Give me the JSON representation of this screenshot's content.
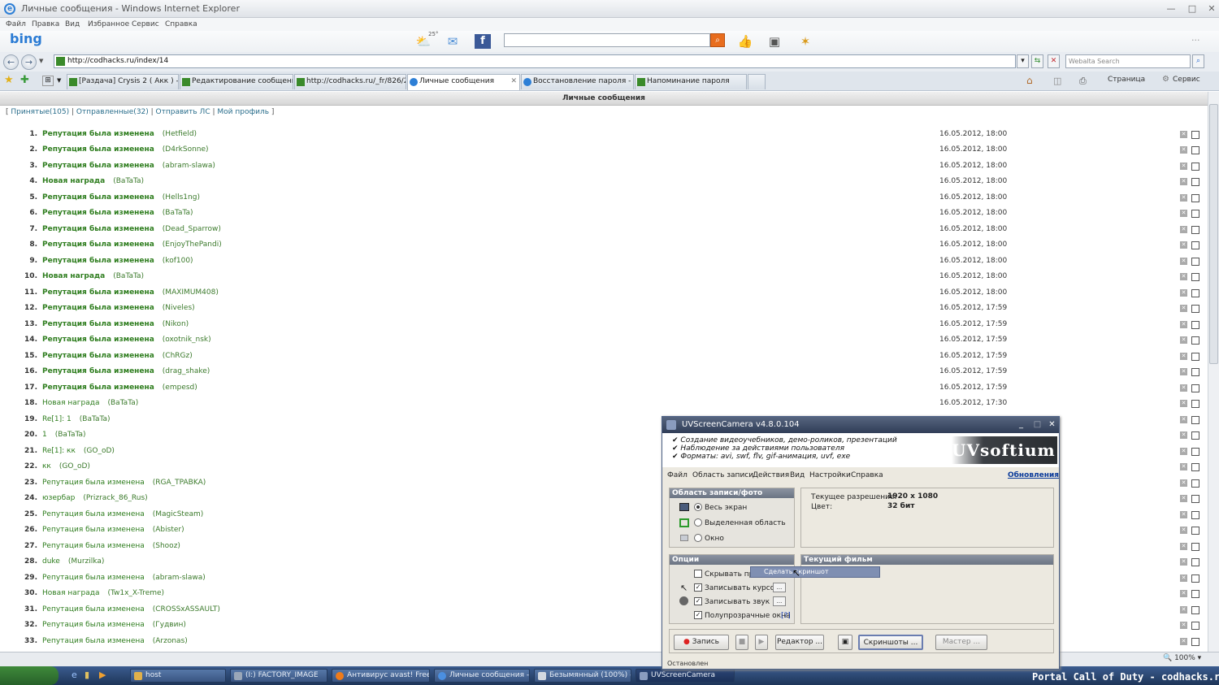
{
  "window": {
    "title": "Личные сообщения - Windows Internet Explorer"
  },
  "menu": [
    "Файл",
    "Правка",
    "Вид",
    "Избранное",
    "Сервис",
    "Справка"
  ],
  "bing": {
    "logo": "bing",
    "weather_temp": "25°"
  },
  "address": {
    "url": "http://codhacks.ru/index/14"
  },
  "websearch": {
    "placeholder": "Webalta Search"
  },
  "tabs": [
    "[Раздача] Crysis 2 ( Акк ) - ...",
    "Редактирование сообщени...",
    "http://codhacks.ru/_fr/826/2...",
    "Личные сообщения",
    "Восстановление пароля - w...",
    "Напоминание пароля"
  ],
  "commands": {
    "page": "Страница",
    "tools": "Сервис"
  },
  "page": {
    "header": "Личные сообщения",
    "links": {
      "inbox": "Принятые(105)",
      "sent": "Отправленные(32)",
      "send": "Отправить ЛС",
      "profile": "Мой профиль"
    },
    "messages": [
      {
        "n": "1.",
        "s": "Репутация была изменена",
        "a": "(Hetfield)",
        "d": "16.05.2012, 18:00",
        "bold": true
      },
      {
        "n": "2.",
        "s": "Репутация была изменена",
        "a": "(D4rkSonne)",
        "d": "16.05.2012, 18:00",
        "bold": true
      },
      {
        "n": "3.",
        "s": "Репутация была изменена",
        "a": "(abram-slawa)",
        "d": "16.05.2012, 18:00",
        "bold": true
      },
      {
        "n": "4.",
        "s": "Новая награда",
        "a": "(BaTaTa)",
        "d": "16.05.2012, 18:00",
        "bold": true
      },
      {
        "n": "5.",
        "s": "Репутация была изменена",
        "a": "(Hells1ng)",
        "d": "16.05.2012, 18:00",
        "bold": true
      },
      {
        "n": "6.",
        "s": "Репутация была изменена",
        "a": "(BaTaTa)",
        "d": "16.05.2012, 18:00",
        "bold": true
      },
      {
        "n": "7.",
        "s": "Репутация была изменена",
        "a": "(Dead_Sparrow)",
        "d": "16.05.2012, 18:00",
        "bold": true
      },
      {
        "n": "8.",
        "s": "Репутация была изменена",
        "a": "(EnjoyThePandi)",
        "d": "16.05.2012, 18:00",
        "bold": true
      },
      {
        "n": "9.",
        "s": "Репутация была изменена",
        "a": "(kof100)",
        "d": "16.05.2012, 18:00",
        "bold": true
      },
      {
        "n": "10.",
        "s": "Новая награда",
        "a": "(BaTaTa)",
        "d": "16.05.2012, 18:00",
        "bold": true
      },
      {
        "n": "11.",
        "s": "Репутация была изменена",
        "a": "(MAXIMUM408)",
        "d": "16.05.2012, 18:00",
        "bold": true
      },
      {
        "n": "12.",
        "s": "Репутация была изменена",
        "a": "(Niveles)",
        "d": "16.05.2012, 17:59",
        "bold": true
      },
      {
        "n": "13.",
        "s": "Репутация была изменена",
        "a": "(Nikon)",
        "d": "16.05.2012, 17:59",
        "bold": true
      },
      {
        "n": "14.",
        "s": "Репутация была изменена",
        "a": "(oxotnik_nsk)",
        "d": "16.05.2012, 17:59",
        "bold": true
      },
      {
        "n": "15.",
        "s": "Репутация была изменена",
        "a": "(ChRGz)",
        "d": "16.05.2012, 17:59",
        "bold": true
      },
      {
        "n": "16.",
        "s": "Репутация была изменена",
        "a": "(drag_shake)",
        "d": "16.05.2012, 17:59",
        "bold": true
      },
      {
        "n": "17.",
        "s": "Репутация была изменена",
        "a": "(empesd)",
        "d": "16.05.2012, 17:59",
        "bold": true
      },
      {
        "n": "18.",
        "s": "Новая награда",
        "a": "(BaTaTa)",
        "d": "16.05.2012, 17:30",
        "bold": false
      },
      {
        "n": "19.",
        "s": "Re[1]: 1",
        "a": "(BaTaTa)",
        "d": "",
        "bold": false
      },
      {
        "n": "20.",
        "s": "1",
        "a": "(BaTaTa)",
        "d": "",
        "bold": false
      },
      {
        "n": "21.",
        "s": "Re[1]: кк",
        "a": "(GO_oD)",
        "d": "",
        "bold": false
      },
      {
        "n": "22.",
        "s": "кк",
        "a": "(GO_oD)",
        "d": "",
        "bold": false
      },
      {
        "n": "23.",
        "s": "Репутация была изменена",
        "a": "(RGA_TPABKA)",
        "d": "",
        "bold": false
      },
      {
        "n": "24.",
        "s": "юзербар",
        "a": "(Prizrack_86_Rus)",
        "d": "",
        "bold": false
      },
      {
        "n": "25.",
        "s": "Репутация была изменена",
        "a": "(MagicSteam)",
        "d": "",
        "bold": false
      },
      {
        "n": "26.",
        "s": "Репутация была изменена",
        "a": "(Abister)",
        "d": "",
        "bold": false
      },
      {
        "n": "27.",
        "s": "Репутация была изменена",
        "a": "(Shooz)",
        "d": "",
        "bold": false
      },
      {
        "n": "28.",
        "s": "duke",
        "a": "(Murzilka)",
        "d": "",
        "bold": false
      },
      {
        "n": "29.",
        "s": "Репутация была изменена",
        "a": "(abram-slawa)",
        "d": "",
        "bold": false
      },
      {
        "n": "30.",
        "s": "Новая награда",
        "a": "(Tw1x_X-Treme)",
        "d": "",
        "bold": false
      },
      {
        "n": "31.",
        "s": "Репутация была изменена",
        "a": "(CROSSxASSAULT)",
        "d": "",
        "bold": false
      },
      {
        "n": "32.",
        "s": "Репутация была изменена",
        "a": "(Гудвин)",
        "d": "",
        "bold": false
      },
      {
        "n": "33.",
        "s": "Репутация была изменена",
        "a": "(Arzonas)",
        "d": "",
        "bold": false
      }
    ]
  },
  "status": {
    "zoom": "100%"
  },
  "taskbar": [
    "host",
    "(I:) FACTORY_IMAGE",
    "Антивирус avast! Free",
    "Личные сообщения - ...",
    "Безымянный (100%) -...",
    "UVScreenCamera"
  ],
  "watermark": "Portal Call of Duty - codhacks.ru",
  "uv": {
    "title": "UVScreenCamera v4.8.0.104",
    "features": [
      "Создание видеоучебников, демо-роликов, презентаций",
      "Наблюдение за действиями пользователя",
      "Форматы: avi, swf, flv, gif-анимация, uvf, exe"
    ],
    "logo": "UVsoftium",
    "menu": [
      "Файл",
      "Область записи",
      "Действия",
      "Вид",
      "Настройки",
      "Справка"
    ],
    "updates": "Обновления",
    "area": {
      "title": "Область записи/фото",
      "opts": [
        "Весь экран",
        "Выделенная область",
        "Окно"
      ]
    },
    "info": {
      "res_label": "Текущее разрешение:",
      "res": "1920 x 1080",
      "color_label": "Цвет:",
      "color": "32 бит"
    },
    "options": {
      "title": "Опции",
      "hide": "Скрывать при",
      "cursor": "Записывать курсор",
      "sound": "Записывать звук",
      "trans": "Полупрозрачные окна",
      "help": "[?]"
    },
    "film": {
      "title": "Текущий фильм"
    },
    "tooltip": "Сделать скриншот",
    "buttons": {
      "record": "Запись",
      "editor": "Редактор ...",
      "screens": "Скриншоты ...",
      "master": "Мастер ..."
    },
    "status": "Остановлен"
  }
}
